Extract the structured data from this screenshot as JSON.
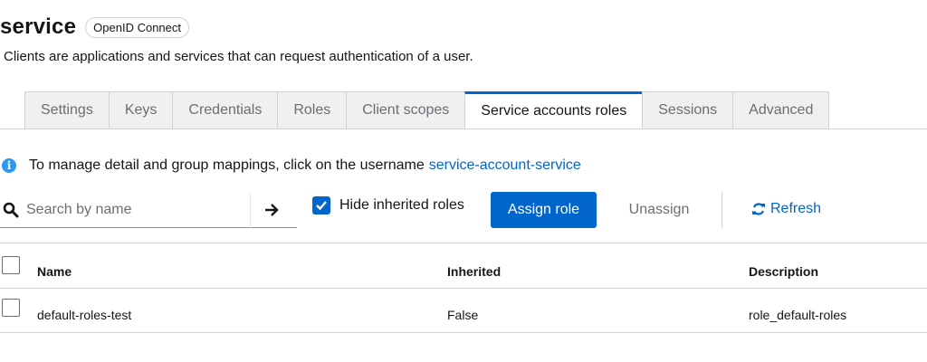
{
  "header": {
    "title": "service",
    "badge": "OpenID Connect",
    "subtitle": "Clients are applications and services that can request authentication of a user."
  },
  "tabs": [
    {
      "label": "Settings",
      "active": false
    },
    {
      "label": "Keys",
      "active": false
    },
    {
      "label": "Credentials",
      "active": false
    },
    {
      "label": "Roles",
      "active": false
    },
    {
      "label": "Client scopes",
      "active": false
    },
    {
      "label": "Service accounts roles",
      "active": true
    },
    {
      "label": "Sessions",
      "active": false
    },
    {
      "label": "Advanced",
      "active": false
    }
  ],
  "info": {
    "icon": "info-icon",
    "text": "To manage detail and group mappings, click on the username",
    "link": "service-account-service"
  },
  "toolbar": {
    "search_placeholder": "Search by name",
    "hide_inherited_label": "Hide inherited roles",
    "hide_inherited_checked": true,
    "assign_label": "Assign role",
    "unassign_label": "Unassign",
    "refresh_label": "Refresh"
  },
  "table": {
    "columns": [
      "Name",
      "Inherited",
      "Description"
    ],
    "rows": [
      {
        "name": "default-roles-test",
        "inherited": "False",
        "description": "role_default-roles"
      }
    ]
  },
  "colors": {
    "accent": "#0066cc",
    "info": "#2b9af3"
  }
}
